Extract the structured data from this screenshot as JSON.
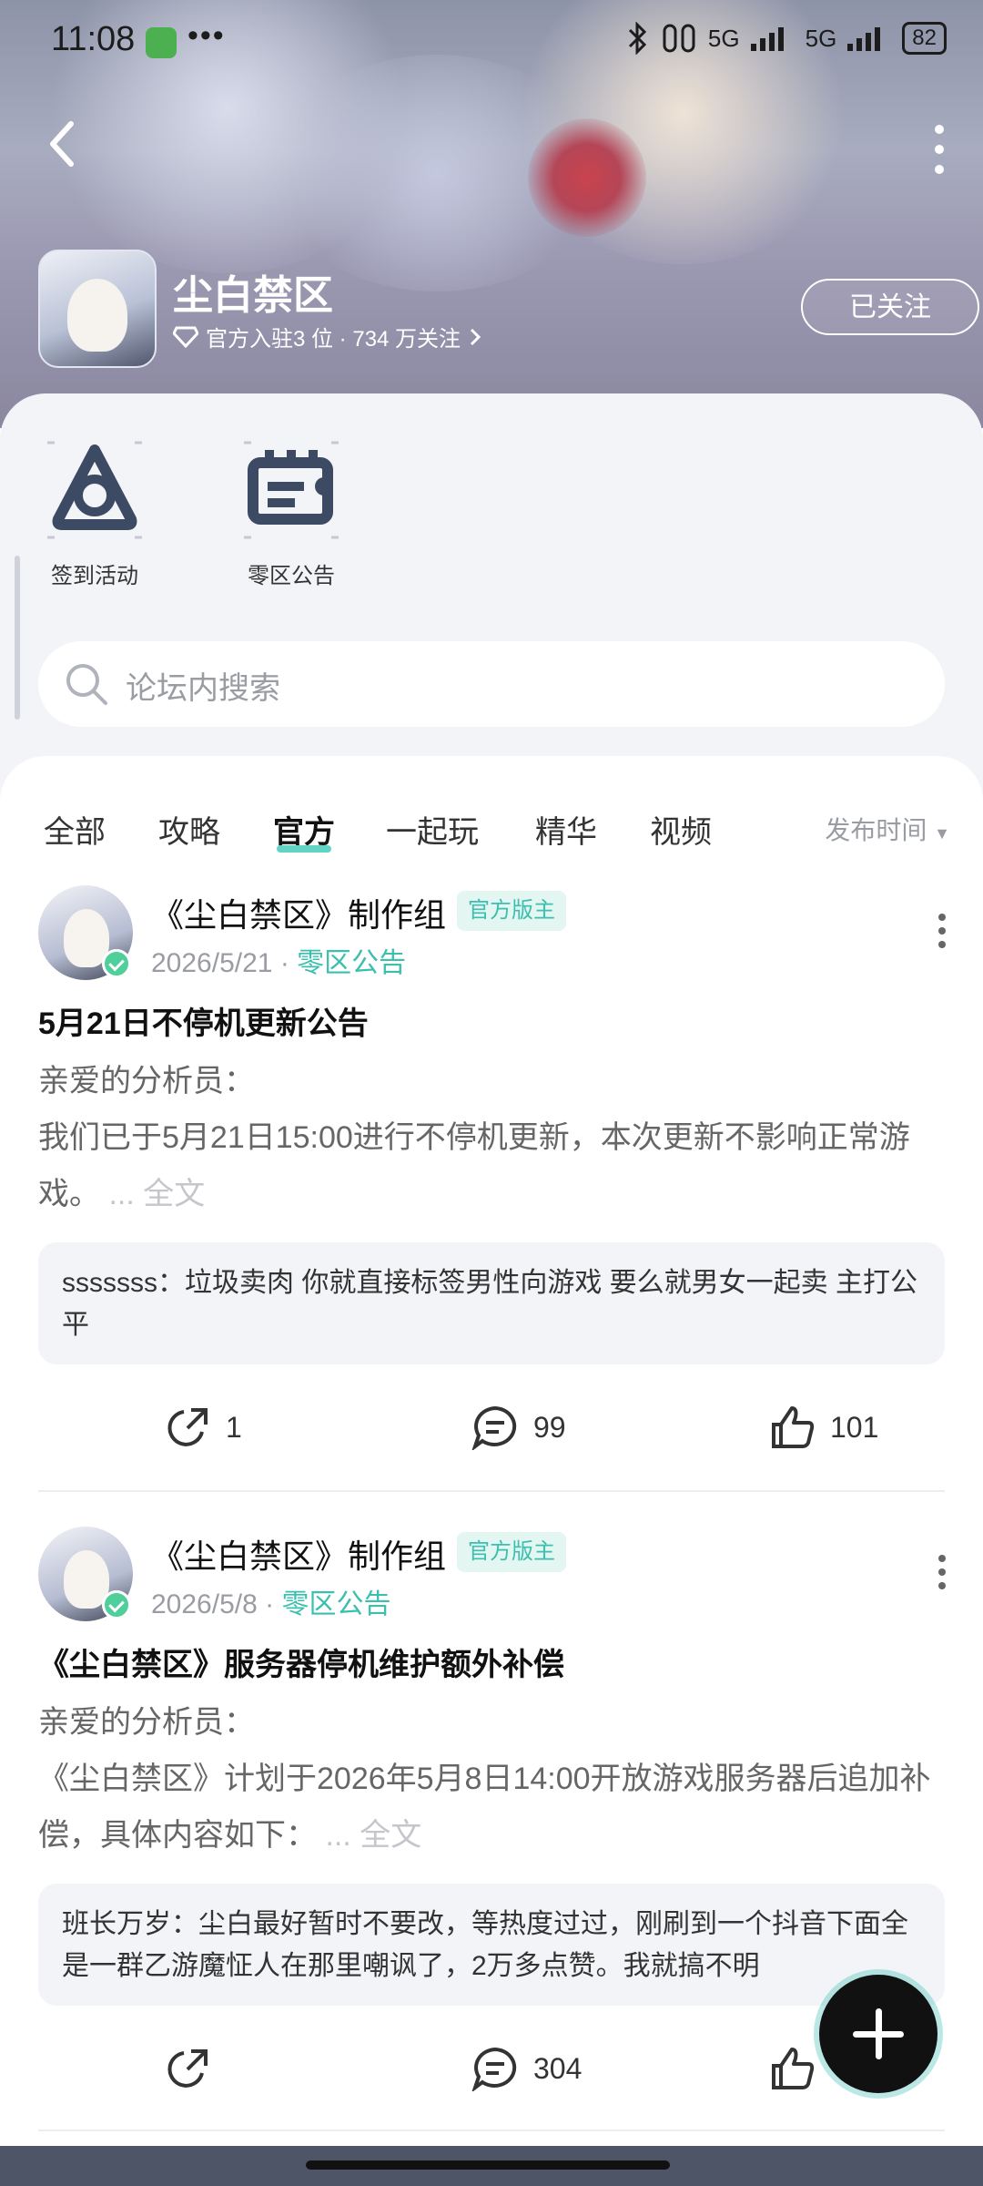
{
  "status_bar": {
    "time": "11:08",
    "more": "•••",
    "battery": "82",
    "net1": "5G",
    "net2": "5G"
  },
  "header": {
    "game_title": "尘白禁区",
    "subtitle": "官方入驻3 位 · 734 万关注",
    "follow_label": "已关注"
  },
  "shortcuts": [
    {
      "label": "签到活动",
      "icon": "signin-icon"
    },
    {
      "label": "零区公告",
      "icon": "announcement-icon"
    }
  ],
  "search": {
    "placeholder": "论坛内搜索"
  },
  "tabs": [
    "全部",
    "攻略",
    "官方",
    "一起玩",
    "精华",
    "视频"
  ],
  "active_tab": "官方",
  "sort_label": "发布时间",
  "posts": [
    {
      "author": "《尘白禁区》制作组",
      "badge": "官方版主",
      "date": "2026/5/21",
      "category": "零区公告",
      "title": "5月21日不停机更新公告",
      "body_line1": "亲爱的分析员：",
      "body_line2": " 我们已于5月21日15:00进行不停机更新，本次更新不影响正常游戏。",
      "more": "... 全文",
      "comment": "sssssss：垃圾卖肉 你就直接标签男性向游戏 要么就男女一起卖 主打公平",
      "shares": "1",
      "comments": "99",
      "likes": "101"
    },
    {
      "author": "《尘白禁区》制作组",
      "badge": "官方版主",
      "date": "2026/5/8",
      "category": "零区公告",
      "title": "《尘白禁区》服务器停机维护额外补偿",
      "body_line1": "亲爱的分析员：",
      "body_line2": "《尘白禁区》计划于2026年5月8日14:00开放游戏服务器后追加补偿，具体内容如下：",
      "more": "... 全文",
      "comment": "班长万岁：尘白最好暂时不要改，等热度过过，刚刷到一个抖音下面全是一群乙游魔怔人在那里嘲讽了，2万多点赞。我就搞不明",
      "shares": "",
      "comments": "304",
      "likes": ""
    }
  ],
  "colors": {
    "accent": "#3cbfae",
    "panel_bg": "#f3f4f7",
    "text_muted": "#9a9ca3"
  }
}
